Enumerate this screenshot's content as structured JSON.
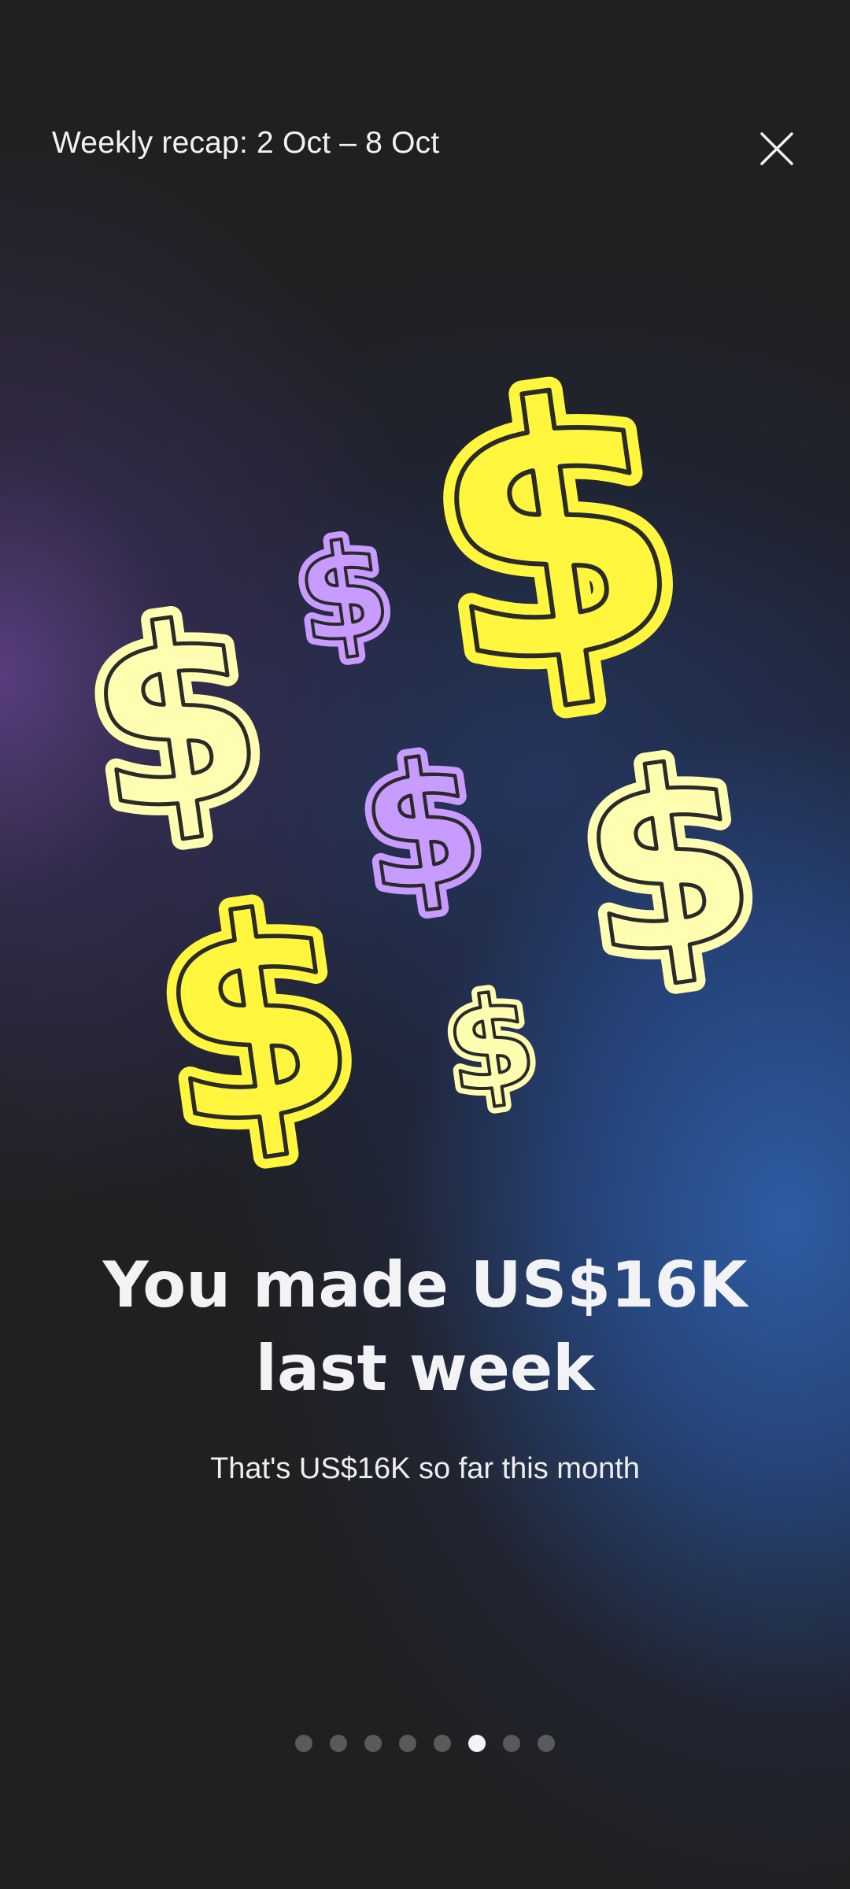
{
  "header": {
    "title": "Weekly recap: 2 Oct – 8 Oct",
    "close_icon": "close-icon"
  },
  "illustration": {
    "icon": "dollar-sign-icon",
    "symbol": "$",
    "colors": {
      "bright_yellow": "#FFF63D",
      "pale_yellow": "#FFFDB0",
      "lavender": "#C79BFF",
      "outline": "#2A2A2A"
    }
  },
  "main": {
    "headline": "You made US$16K last week",
    "subtext": "That's US$16K so far this month"
  },
  "pager": {
    "total": 8,
    "active_index": 5
  },
  "colors": {
    "background": "#202021",
    "glow_purple": "#62428C",
    "glow_blue": "#2E5CA4",
    "text_primary": "#F3F3F5",
    "dot_inactive": "#5A5A5C",
    "dot_active": "#F5F5F7"
  }
}
